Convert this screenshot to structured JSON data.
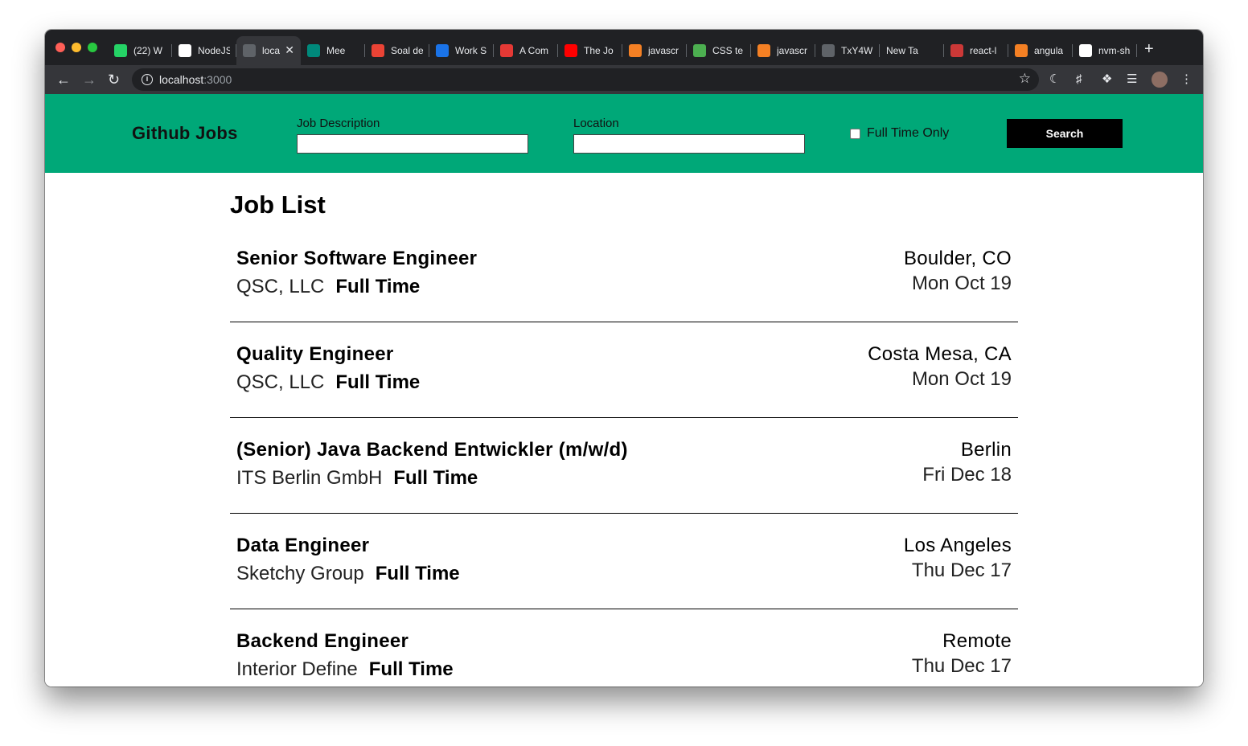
{
  "browser": {
    "tabs": [
      {
        "title": "(22) W",
        "icon": "whatsapp-icon",
        "color": "#25d366",
        "badge": "22"
      },
      {
        "title": "NodeJS",
        "icon": "github-icon",
        "color": "#ffffff"
      },
      {
        "title": "loca",
        "icon": "page-icon",
        "color": "#5f6368",
        "active": true
      },
      {
        "title": "Mee",
        "icon": "google-meet-icon",
        "color": "#00897b"
      },
      {
        "title": "Soal de",
        "icon": "gmail-icon",
        "color": "#ea4335"
      },
      {
        "title": "Work S",
        "icon": "f-icon",
        "color": "#1a73e8"
      },
      {
        "title": "A Com",
        "icon": "asterisk-icon",
        "color": "#e53935"
      },
      {
        "title": "The Jo",
        "icon": "youtube-icon",
        "color": "#ff0000"
      },
      {
        "title": "javascr",
        "icon": "stackoverflow-icon",
        "color": "#f48024"
      },
      {
        "title": "CSS te",
        "icon": "w3-icon",
        "color": "#4caf50"
      },
      {
        "title": "javascr",
        "icon": "stackoverflow-icon",
        "color": "#f48024"
      },
      {
        "title": "TxY4W",
        "icon": "globe-icon",
        "color": "#5f6368"
      },
      {
        "title": "New Tab",
        "icon": "none",
        "color": "#202124"
      },
      {
        "title": "react-l",
        "icon": "npm-icon",
        "color": "#cb3837"
      },
      {
        "title": "angula",
        "icon": "stackoverflow-icon",
        "color": "#f48024"
      },
      {
        "title": "nvm-sh",
        "icon": "github-icon",
        "color": "#ffffff"
      }
    ],
    "url_host": "localhost",
    "url_port": ":3000"
  },
  "header": {
    "brand": "Github Jobs",
    "description_label": "Job Description",
    "description_value": "",
    "location_label": "Location",
    "location_value": "",
    "fulltime_label": "Full Time Only",
    "fulltime_checked": false,
    "search_label": "Search",
    "color": "#00a878"
  },
  "main": {
    "title": "Job List",
    "jobs": [
      {
        "title": "Senior Software Engineer",
        "company": "QSC, LLC",
        "type": "Full Time",
        "location": "Boulder, CO",
        "date": "Mon Oct 19"
      },
      {
        "title": "Quality Engineer",
        "company": "QSC, LLC",
        "type": "Full Time",
        "location": "Costa Mesa, CA",
        "date": "Mon Oct 19"
      },
      {
        "title": "(Senior) Java Backend Entwickler (m/w/d)",
        "company": "ITS Berlin GmbH",
        "type": "Full Time",
        "location": "Berlin",
        "date": "Fri Dec 18"
      },
      {
        "title": "Data Engineer",
        "company": "Sketchy Group",
        "type": "Full Time",
        "location": "Los Angeles",
        "date": "Thu Dec 17"
      },
      {
        "title": "Backend Engineer",
        "company": "Interior Define",
        "type": "Full Time",
        "location": "Remote",
        "date": "Thu Dec 17"
      }
    ]
  }
}
